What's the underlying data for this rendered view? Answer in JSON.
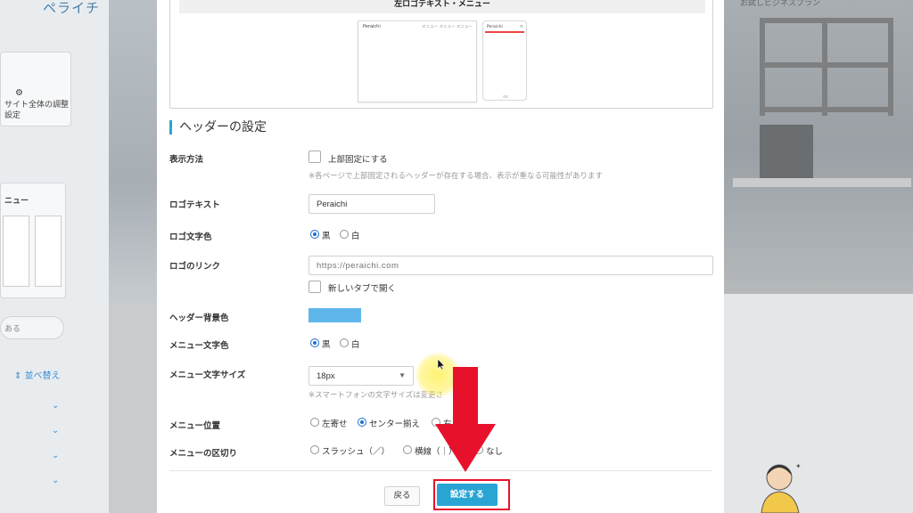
{
  "background_app": {
    "logo_text": "ペライチ",
    "site_settings_label": "サイト全体の調整設定",
    "menu_label": "ニュー",
    "sort_label": "並べ替え",
    "plan_text": "お試しビジネスプラン",
    "search_placeholder": "ある"
  },
  "preview": {
    "caption": "左ロゴテキスト・メニュー",
    "pc_logo": "Peraichi",
    "pc_menu": "メニュー メニュー メニュー",
    "sp_logo": "Peraichi"
  },
  "section": {
    "heading": "ヘッダーの設定"
  },
  "fields": {
    "display_method": {
      "label": "表示方法",
      "checkbox_label": "上部固定にする",
      "hint": "※各ページで上部固定されるヘッダーが存在する場合、表示が重なる可能性があります"
    },
    "logo_text": {
      "label": "ロゴテキスト",
      "value": "Peraichi"
    },
    "logo_color": {
      "label": "ロゴ文字色",
      "options": [
        "黒",
        "白"
      ],
      "selected": "黒"
    },
    "logo_link": {
      "label": "ロゴのリンク",
      "placeholder": "https://peraichi.com",
      "new_tab_label": "新しいタブで開く"
    },
    "header_bg": {
      "label": "ヘッダー背景色",
      "color": "#5fb6ea"
    },
    "menu_color": {
      "label": "メニュー文字色",
      "options": [
        "黒",
        "白"
      ],
      "selected": "黒"
    },
    "menu_size": {
      "label": "メニュー文字サイズ",
      "value": "18px",
      "hint": "※スマートフォンの文字サイズは変更さ"
    },
    "menu_position": {
      "label": "メニュー位置",
      "options": [
        "左寄せ",
        "センター揃え",
        "右"
      ],
      "selected": "センター揃え"
    },
    "menu_separator": {
      "label": "メニューの区切り",
      "options": [
        "スラッシュ（／）",
        "横線（｜）",
        "なし"
      ]
    }
  },
  "footer": {
    "back_label": "戻る",
    "submit_label": "設定する"
  },
  "colors": {
    "accent": "#29a5d4",
    "highlight": "#e8112b"
  }
}
